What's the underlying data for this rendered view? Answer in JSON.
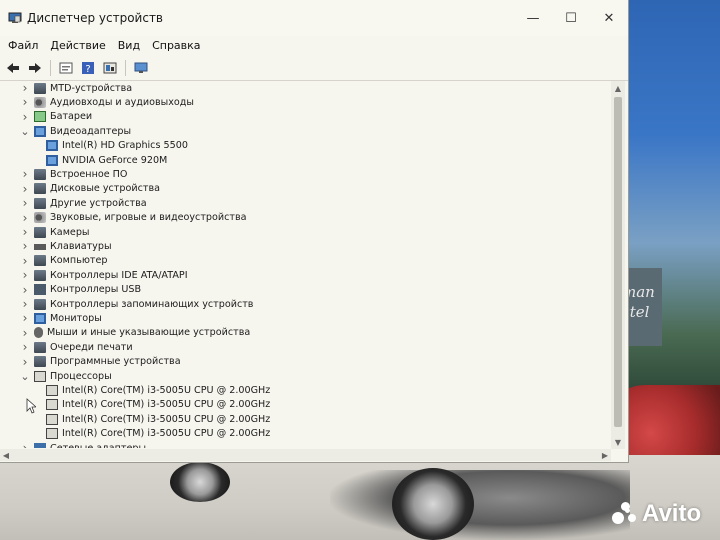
{
  "window": {
    "title": "Диспетчер устройств",
    "controls": {
      "minimize": "—",
      "maximize": "☐",
      "close": "✕"
    }
  },
  "menu": [
    "Файл",
    "Действие",
    "Вид",
    "Справка"
  ],
  "toolbar_icons": [
    "back-arrow-icon",
    "forward-arrow-icon",
    "properties-icon",
    "help-icon",
    "device-view-icon",
    "monitor-icon"
  ],
  "tree": [
    {
      "label": "MTD-устройства",
      "level": 0,
      "expanded": false,
      "icon": "generic-device-icon"
    },
    {
      "label": "Аудиовходы и аудиовыходы",
      "level": 0,
      "expanded": false,
      "icon": "speaker-icon"
    },
    {
      "label": "Батареи",
      "level": 0,
      "expanded": false,
      "icon": "battery-icon"
    },
    {
      "label": "Видеоадаптеры",
      "level": 0,
      "expanded": true,
      "icon": "display-adapter-icon"
    },
    {
      "label": "Intel(R) HD Graphics 5500",
      "level": 1,
      "icon": "display-adapter-icon"
    },
    {
      "label": "NVIDIA GeForce 920M",
      "level": 1,
      "icon": "display-adapter-icon"
    },
    {
      "label": "Встроенное ПО",
      "level": 0,
      "expanded": false,
      "icon": "firmware-icon"
    },
    {
      "label": "Дисковые устройства",
      "level": 0,
      "expanded": false,
      "icon": "disk-icon"
    },
    {
      "label": "Другие устройства",
      "level": 0,
      "expanded": false,
      "icon": "unknown-device-icon"
    },
    {
      "label": "Звуковые, игровые и видеоустройства",
      "level": 0,
      "expanded": false,
      "icon": "sound-icon"
    },
    {
      "label": "Камеры",
      "level": 0,
      "expanded": false,
      "icon": "camera-icon"
    },
    {
      "label": "Клавиатуры",
      "level": 0,
      "expanded": false,
      "icon": "keyboard-icon"
    },
    {
      "label": "Компьютер",
      "level": 0,
      "expanded": false,
      "icon": "computer-icon"
    },
    {
      "label": "Контроллеры IDE ATA/ATAPI",
      "level": 0,
      "expanded": false,
      "icon": "ide-controller-icon"
    },
    {
      "label": "Контроллеры USB",
      "level": 0,
      "expanded": false,
      "icon": "usb-icon"
    },
    {
      "label": "Контроллеры запоминающих устройств",
      "level": 0,
      "expanded": false,
      "icon": "storage-controller-icon"
    },
    {
      "label": "Мониторы",
      "level": 0,
      "expanded": false,
      "icon": "monitor-icon"
    },
    {
      "label": "Мыши и иные указывающие устройства",
      "level": 0,
      "expanded": false,
      "icon": "mouse-icon"
    },
    {
      "label": "Очереди печати",
      "level": 0,
      "expanded": false,
      "icon": "printer-icon"
    },
    {
      "label": "Программные устройства",
      "level": 0,
      "expanded": false,
      "icon": "software-device-icon"
    },
    {
      "label": "Процессоры",
      "level": 0,
      "expanded": true,
      "icon": "processor-icon"
    },
    {
      "label": "Intel(R) Core(TM) i3-5005U CPU @ 2.00GHz",
      "level": 1,
      "icon": "processor-icon"
    },
    {
      "label": "Intel(R) Core(TM) i3-5005U CPU @ 2.00GHz",
      "level": 1,
      "icon": "processor-icon"
    },
    {
      "label": "Intel(R) Core(TM) i3-5005U CPU @ 2.00GHz",
      "level": 1,
      "icon": "processor-icon"
    },
    {
      "label": "Intel(R) Core(TM) i3-5005U CPU @ 2.00GHz",
      "level": 1,
      "icon": "processor-icon"
    },
    {
      "label": "Сетевые адаптеры",
      "level": 0,
      "expanded": false,
      "icon": "network-icon"
    }
  ],
  "wallpaper": {
    "sign_text": [
      "man",
      "stel"
    ],
    "watermark": "Avito"
  }
}
